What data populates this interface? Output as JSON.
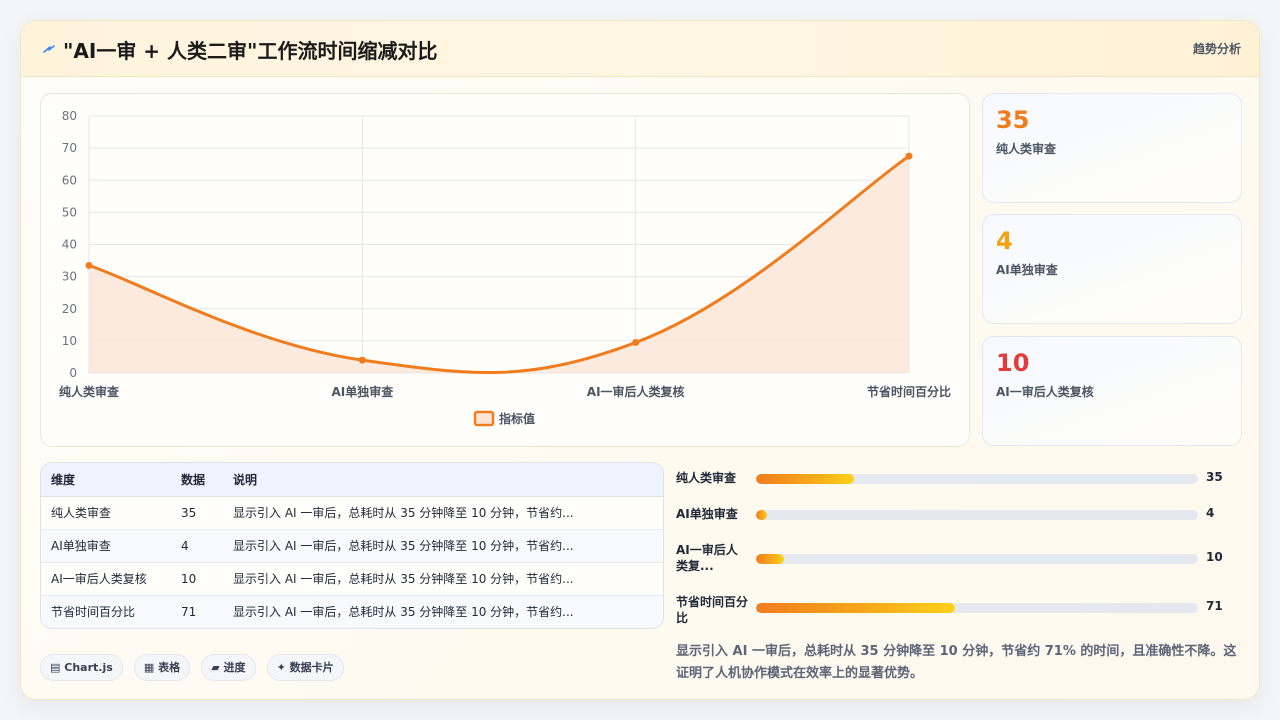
{
  "header": {
    "title": "\"AI一审 + 人类二审\"工作流时间缩减对比",
    "link": "趋势分析"
  },
  "chart_data": {
    "type": "line",
    "categories": [
      "纯人类审查",
      "AI单独审查",
      "AI一审后人类复核",
      "节省时间百分比"
    ],
    "series": [
      {
        "name": "指标值",
        "values": [
          33.5,
          4,
          9.5,
          67.5
        ]
      }
    ],
    "ylim": [
      0,
      80
    ],
    "yticks": [
      0,
      10,
      20,
      30,
      40,
      50,
      60,
      70,
      80
    ],
    "grid": true,
    "legend": "bottom",
    "line_color": "#f07c1e",
    "fill_color": "#fde6d8"
  },
  "stats": [
    {
      "value": "35",
      "label": "纯人类审查",
      "color": "#f07c1e"
    },
    {
      "value": "4",
      "label": "AI单独审查",
      "color": "#f5a10f"
    },
    {
      "value": "10",
      "label": "AI一审后人类复核",
      "color": "#e23b3b"
    }
  ],
  "table": {
    "headers": [
      "维度",
      "数据",
      "说明"
    ],
    "rows": [
      [
        "纯人类审查",
        "35",
        "显示引入 AI 一审后，总耗时从 35 分钟降至 10 分钟，节省约..."
      ],
      [
        "AI单独审查",
        "4",
        "显示引入 AI 一审后，总耗时从 35 分钟降至 10 分钟，节省约..."
      ],
      [
        "AI一审后人类复核",
        "10",
        "显示引入 AI 一审后，总耗时从 35 分钟降至 10 分钟，节省约..."
      ],
      [
        "节省时间百分比",
        "71",
        "显示引入 AI 一审后，总耗时从 35 分钟降至 10 分钟，节省约..."
      ]
    ]
  },
  "progress": {
    "max": 71,
    "items": [
      {
        "label": "纯人类审查",
        "value": "35"
      },
      {
        "label": "AI单独审查",
        "value": "4"
      },
      {
        "label": "AI一审后人\n类复...",
        "value": "10"
      },
      {
        "label": "节省时间百分比",
        "value": "71"
      }
    ]
  },
  "summary": "显示引入 AI 一审后，总耗时从 35 分钟降至 10 分钟，节省约 71% 的时间，且准确性不降。这证明了人机协作模式在效率上的显著优势。",
  "tags": [
    {
      "icon": "▤",
      "label": "Chart.js"
    },
    {
      "icon": "▦",
      "label": "表格"
    },
    {
      "icon": "▰",
      "label": "进度"
    },
    {
      "icon": "✦",
      "label": "数据卡片"
    }
  ]
}
